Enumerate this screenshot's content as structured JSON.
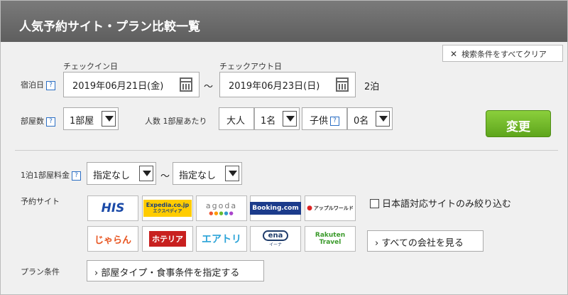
{
  "header": {
    "title": "人気予約サイト・プラン比較一覧"
  },
  "clear_button": {
    "icon": "close-icon",
    "label": "検索条件をすべてクリア"
  },
  "dates": {
    "label": "宿泊日",
    "help": "?",
    "checkin_label": "チェックイン日",
    "checkin_value": "2019年06月21日(金)",
    "separator": "～",
    "checkout_label": "チェックアウト日",
    "checkout_value": "2019年06月23日(日)",
    "nights": "2泊"
  },
  "rooms": {
    "label": "部屋数",
    "help": "?",
    "value": "1部屋"
  },
  "people": {
    "label": "人数 1部屋あたり",
    "adult_label": "大人",
    "adult_value": "1名",
    "child_label": "子供",
    "child_help": "?",
    "child_value": "0名"
  },
  "change_button": {
    "label": "変更"
  },
  "price": {
    "label": "1泊1部屋料金",
    "help": "?",
    "min_value": "指定なし",
    "separator": "～",
    "max_value": "指定なし"
  },
  "sites": {
    "label": "予約サイト",
    "items": [
      {
        "name": "HIS",
        "color": "#1a4aa8"
      },
      {
        "name": "Expedia.co.jp",
        "sub": "エクスペディア",
        "color": "#1d3f7a",
        "bg": "#ffcc00"
      },
      {
        "name": "agoda",
        "color": "#777"
      },
      {
        "name": "Booking.com",
        "color": "#ffffff",
        "bg": "#1b3b8b"
      },
      {
        "name": "アップルワールド",
        "color": "#333"
      },
      {
        "name": "じゃらん",
        "color": "#e8541f"
      },
      {
        "name": "ホテリア",
        "color": "#ffffff",
        "bg": "#c8201f"
      },
      {
        "name": "エアトリ",
        "color": "#2aa3d8"
      },
      {
        "name": "ena",
        "sub": "イーナ",
        "color": "#1f3c6b"
      },
      {
        "name": "Rakuten",
        "sub": "Travel",
        "color": "#3a9a2a"
      }
    ],
    "japanese_only": "日本語対応サイトのみ絞り込む",
    "see_all": "› すべての会社を見る"
  },
  "plan": {
    "label": "プラン条件",
    "button": "› 部屋タイプ・食事条件を指定する"
  }
}
